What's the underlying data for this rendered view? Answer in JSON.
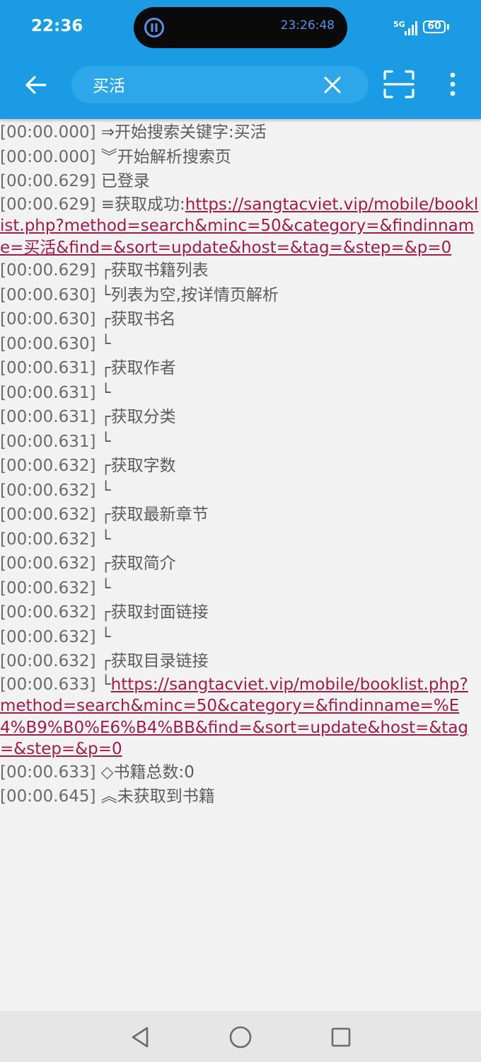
{
  "status_bar": {
    "time": "22:36",
    "island_timer": "23:26:48",
    "network": "5G",
    "battery": "60"
  },
  "toolbar": {
    "search_value": "买活",
    "back_icon": "arrow-left-icon",
    "clear_icon": "close-icon",
    "scan_icon": "scan-icon",
    "more_icon": "more-vert-icon"
  },
  "log": [
    {
      "ts": "[00:00.000]",
      "text": " ⇒开始搜索关键字:买活"
    },
    {
      "ts": "[00:00.000]",
      "text": " ︾开始解析搜索页"
    },
    {
      "ts": "[00:00.629]",
      "text": " 已登录"
    },
    {
      "ts": "[00:00.629]",
      "text": " ≡获取成功:",
      "link": "https://sangtacviet.vip/mobile/booklist.php?method=search&minc=50&category=&findinname=买活&find=&sort=update&host=&tag=&step=&p=0"
    },
    {
      "ts": "[00:00.629]",
      "text": " ┌获取书籍列表"
    },
    {
      "ts": "[00:00.630]",
      "text": " └列表为空,按详情页解析"
    },
    {
      "ts": "[00:00.630]",
      "text": " ┌获取书名"
    },
    {
      "ts": "[00:00.630]",
      "text": " └"
    },
    {
      "ts": "[00:00.631]",
      "text": " ┌获取作者"
    },
    {
      "ts": "[00:00.631]",
      "text": " └"
    },
    {
      "ts": "[00:00.631]",
      "text": " ┌获取分类"
    },
    {
      "ts": "[00:00.631]",
      "text": " └"
    },
    {
      "ts": "[00:00.632]",
      "text": " ┌获取字数"
    },
    {
      "ts": "[00:00.632]",
      "text": " └"
    },
    {
      "ts": "[00:00.632]",
      "text": " ┌获取最新章节"
    },
    {
      "ts": "[00:00.632]",
      "text": " └"
    },
    {
      "ts": "[00:00.632]",
      "text": " ┌获取简介"
    },
    {
      "ts": "[00:00.632]",
      "text": " └"
    },
    {
      "ts": "[00:00.632]",
      "text": " ┌获取封面链接"
    },
    {
      "ts": "[00:00.632]",
      "text": " └"
    },
    {
      "ts": "[00:00.632]",
      "text": " ┌获取目录链接"
    },
    {
      "ts": "[00:00.633]",
      "text": " └",
      "link": "https://sangtacviet.vip/mobile/booklist.php?method=search&minc=50&category=&findinname=%E4%B9%B0%E6%B4%BB&find=&sort=update&host=&tag=&step=&p=0"
    },
    {
      "ts": "[00:00.633]",
      "text": " ◇书籍总数:0"
    },
    {
      "ts": "[00:00.645]",
      "text": " ︽未获取到书籍"
    }
  ],
  "nav_bar": {
    "back_icon": "triangle-back-icon",
    "home_icon": "circle-home-icon",
    "recent_icon": "square-recents-icon"
  },
  "colors": {
    "appbar": "#1a9be4",
    "search_box": "#2ea6ea",
    "link": "#a01c49",
    "log_text": "#5c5c5c",
    "background": "#f2f2f2"
  }
}
